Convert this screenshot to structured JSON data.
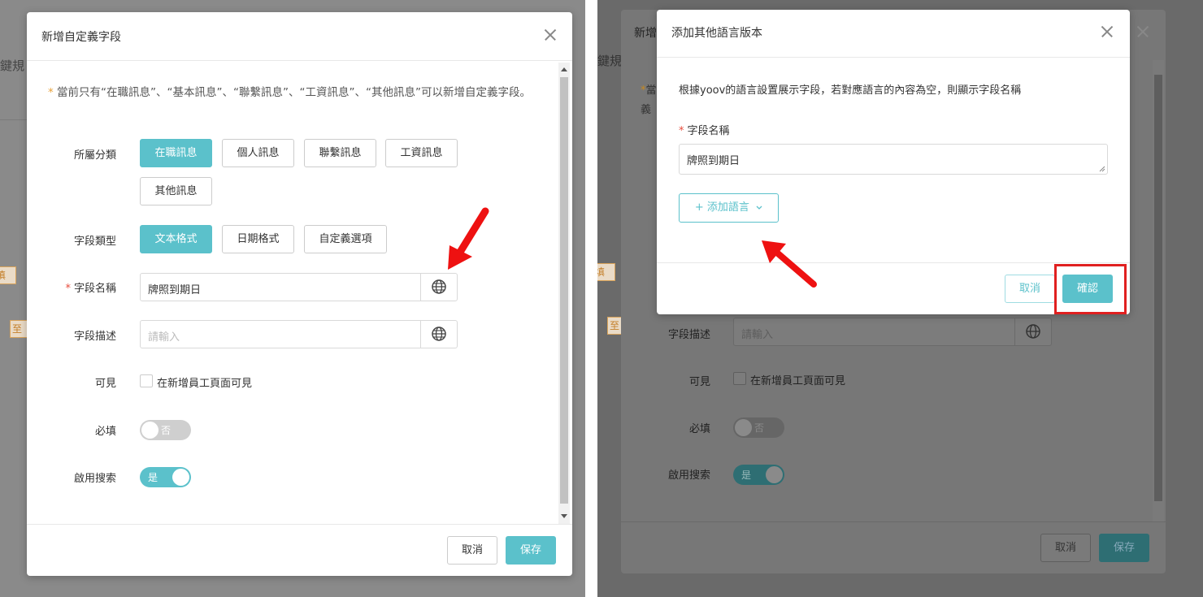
{
  "left_dialog": {
    "title": "新增自定義字段",
    "background_fragments": [
      "鍵規",
      "填",
      "至"
    ],
    "notice_star": "*",
    "notice": "當前只有“在職訊息”、“基本訊息”、“聯繫訊息”、“工資訊息”、“其他訊息”可以新增自定義字段。",
    "category": {
      "label": "所屬分類",
      "options": [
        "在職訊息",
        "個人訊息",
        "聯繫訊息",
        "工資訊息",
        "其他訊息"
      ],
      "selected": "在職訊息"
    },
    "field_type": {
      "label": "字段類型",
      "options": [
        "文本格式",
        "日期格式",
        "自定義選項"
      ],
      "selected": "文本格式"
    },
    "field_name": {
      "label": "字段名稱",
      "value": "牌照到期日"
    },
    "field_desc": {
      "label": "字段描述",
      "placeholder": "請輸入"
    },
    "visible": {
      "label": "可見",
      "checkbox_label": "在新增員工頁面可見",
      "checked": false
    },
    "required": {
      "label": "必填",
      "toggle_text": "否",
      "on": false
    },
    "searchable": {
      "label": "啟用搜索",
      "toggle_text": "是",
      "on": true
    },
    "footer": {
      "cancel": "取消",
      "save": "保存"
    }
  },
  "right_dialog": {
    "background_fragments": [
      "新增",
      "鍵規",
      "當",
      "義",
      "填",
      "至"
    ],
    "bg": {
      "field_desc_label": "字段描述",
      "field_desc_placeholder": "請輸入",
      "visible_label": "可見",
      "checkbox_label": "在新增員工頁面可見",
      "required_label": "必填",
      "required_toggle": "否",
      "search_label": "啟用搜索",
      "search_toggle": "是",
      "cancel": "取消",
      "save": "保存"
    },
    "title": "添加其他語言版本",
    "description": "根據yoov的語言設置展示字段，若對應語言的內容為空，則顯示字段名稱",
    "field_name": {
      "label": "字段名稱",
      "value": "牌照到期日"
    },
    "add_language": "+ 添加語言",
    "footer": {
      "cancel": "取消",
      "confirm": "確認"
    }
  },
  "colors": {
    "accent": "#5bc1cb",
    "highlight": "#e02020",
    "arrow": "#ee1111"
  }
}
